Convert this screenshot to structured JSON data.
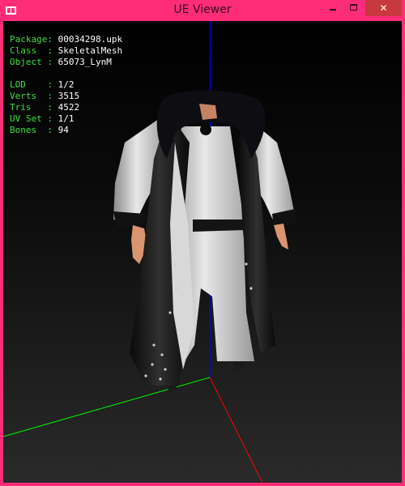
{
  "window": {
    "title": "UE Viewer",
    "close_glyph": "✕"
  },
  "icons": {
    "app": "app-window-icon",
    "minimize": "minimize-icon",
    "maximize": "maximize-icon",
    "close": "close-icon"
  },
  "colors": {
    "titlebar": "#ff2d78",
    "close_button": "#c7383f",
    "info_label": "#3ce03c",
    "info_value": "#ffffff",
    "axis_x": "#ff0000",
    "axis_y": "#00ff00",
    "axis_z": "#0000ff"
  },
  "info": {
    "package": {
      "label": "Package: ",
      "value": "00034298.upk"
    },
    "class": {
      "label": "Class  : ",
      "value": "SkeletalMesh"
    },
    "object": {
      "label": "Object : ",
      "value": "65073_LynM"
    },
    "lod": {
      "label": "LOD    : ",
      "value": "1/2"
    },
    "verts": {
      "label": "Verts  : ",
      "value": "3515"
    },
    "tris": {
      "label": "Tris   : ",
      "value": "4522"
    },
    "uvset": {
      "label": "UV Set : ",
      "value": "1/1"
    },
    "bones": {
      "label": "Bones  : ",
      "value": "94"
    }
  }
}
